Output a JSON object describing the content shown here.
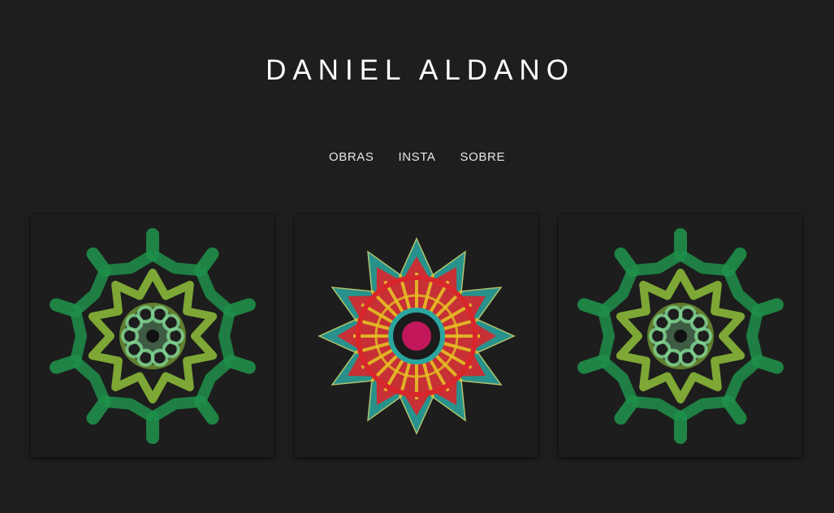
{
  "site": {
    "title": "DANIEL ALDANO"
  },
  "nav": {
    "items": [
      {
        "label": "OBRAS"
      },
      {
        "label": "INSTA"
      },
      {
        "label": "SOBRE"
      }
    ]
  },
  "gallery": {
    "artworks": [
      {
        "style": "green-star-mandala",
        "colors": {
          "outer": "#1f8f4a",
          "middle": "#8fbf3a",
          "inner": "#7fd08f",
          "center": "#111111"
        }
      },
      {
        "style": "colorful-star-mandala",
        "colors": {
          "outer": "#2aa6a0",
          "red": "#d8262b",
          "yellow": "#e5c024",
          "center": "#c2185b"
        }
      },
      {
        "style": "green-star-mandala",
        "colors": {
          "outer": "#1f8f4a",
          "middle": "#8fbf3a",
          "inner": "#7fd08f",
          "center": "#111111"
        }
      }
    ]
  }
}
